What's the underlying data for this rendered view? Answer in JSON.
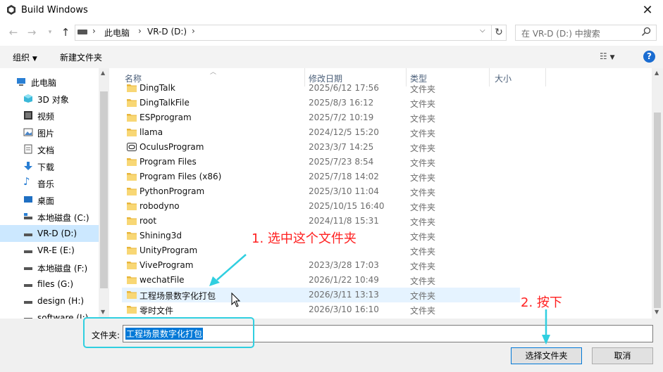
{
  "window": {
    "title": "Build Windows"
  },
  "address": {
    "breadcrumbs": [
      "此电脑",
      "VR-D (D:)"
    ],
    "search_placeholder": "在 VR-D (D:) 中搜索"
  },
  "toolbar": {
    "organize": "组织",
    "new_folder": "新建文件夹"
  },
  "nav": {
    "items": [
      {
        "label": "此电脑",
        "icon": "computer-icon"
      },
      {
        "label": "3D 对象",
        "icon": "3d-objects-icon"
      },
      {
        "label": "视频",
        "icon": "video-icon"
      },
      {
        "label": "图片",
        "icon": "pictures-icon"
      },
      {
        "label": "文档",
        "icon": "documents-icon"
      },
      {
        "label": "下载",
        "icon": "download-icon"
      },
      {
        "label": "音乐",
        "icon": "music-icon"
      },
      {
        "label": "桌面",
        "icon": "desktop-icon"
      },
      {
        "label": "本地磁盘 (C:)",
        "icon": "drive-icon"
      },
      {
        "label": "VR-D (D:)",
        "icon": "drive-icon"
      },
      {
        "label": "VR-E (E:)",
        "icon": "drive-icon"
      },
      {
        "label": "本地磁盘 (F:)",
        "icon": "drive-icon"
      },
      {
        "label": "files (G:)",
        "icon": "drive-icon"
      },
      {
        "label": "design (H:)",
        "icon": "drive-icon"
      },
      {
        "label": "software (I:)",
        "icon": "drive-icon"
      }
    ],
    "selected_index": 9
  },
  "columns": {
    "name": "名称",
    "date": "修改日期",
    "type": "类型",
    "size": "大小"
  },
  "files": [
    {
      "name": "DingTalk",
      "date": "2025/6/12 17:56",
      "type": "文件夹",
      "icon": "folder-icon"
    },
    {
      "name": "DingTalkFile",
      "date": "2025/8/3 16:12",
      "type": "文件夹",
      "icon": "folder-icon"
    },
    {
      "name": "ESPprogram",
      "date": "2025/7/2 10:19",
      "type": "文件夹",
      "icon": "folder-icon"
    },
    {
      "name": "llama",
      "date": "2024/12/5 15:20",
      "type": "文件夹",
      "icon": "folder-icon"
    },
    {
      "name": "OculusProgram",
      "date": "2023/3/7 14:25",
      "type": "文件夹",
      "icon": "oculus-folder-icon"
    },
    {
      "name": "Program Files",
      "date": "2025/7/23 8:54",
      "type": "文件夹",
      "icon": "folder-icon"
    },
    {
      "name": "Program Files (x86)",
      "date": "2025/7/18 14:02",
      "type": "文件夹",
      "icon": "folder-icon"
    },
    {
      "name": "PythonProgram",
      "date": "2025/3/10 11:04",
      "type": "文件夹",
      "icon": "folder-icon"
    },
    {
      "name": "robodyno",
      "date": "2025/10/15 16:40",
      "type": "文件夹",
      "icon": "folder-icon"
    },
    {
      "name": "root",
      "date": "2024/11/8 15:31",
      "type": "文件夹",
      "icon": "folder-icon"
    },
    {
      "name": "Shining3d",
      "date": "",
      "type": "文件夹",
      "icon": "folder-icon"
    },
    {
      "name": "UnityProgram",
      "date": "",
      "type": "文件夹",
      "icon": "folder-icon"
    },
    {
      "name": "ViveProgram",
      "date": "2023/3/28 17:03",
      "type": "文件夹",
      "icon": "folder-icon"
    },
    {
      "name": "wechatFile",
      "date": "2026/1/22 10:49",
      "type": "文件夹",
      "icon": "folder-icon"
    },
    {
      "name": "工程场景数字化打包",
      "date": "2026/3/11 13:13",
      "type": "文件夹",
      "icon": "folder-icon"
    },
    {
      "name": "零时文件",
      "date": "2026/3/10 16:10",
      "type": "文件夹",
      "icon": "folder-icon"
    }
  ],
  "selected_file_index": 14,
  "bottom": {
    "folder_label": "文件夹:",
    "folder_value": "工程场景数字化打包",
    "select_button": "选择文件夹",
    "cancel_button": "取消"
  },
  "annotations": {
    "step1": "1. 选中这个文件夹",
    "step2": "2. 按下",
    "color": "#ff2020",
    "arrow_color": "#30cfe0"
  }
}
